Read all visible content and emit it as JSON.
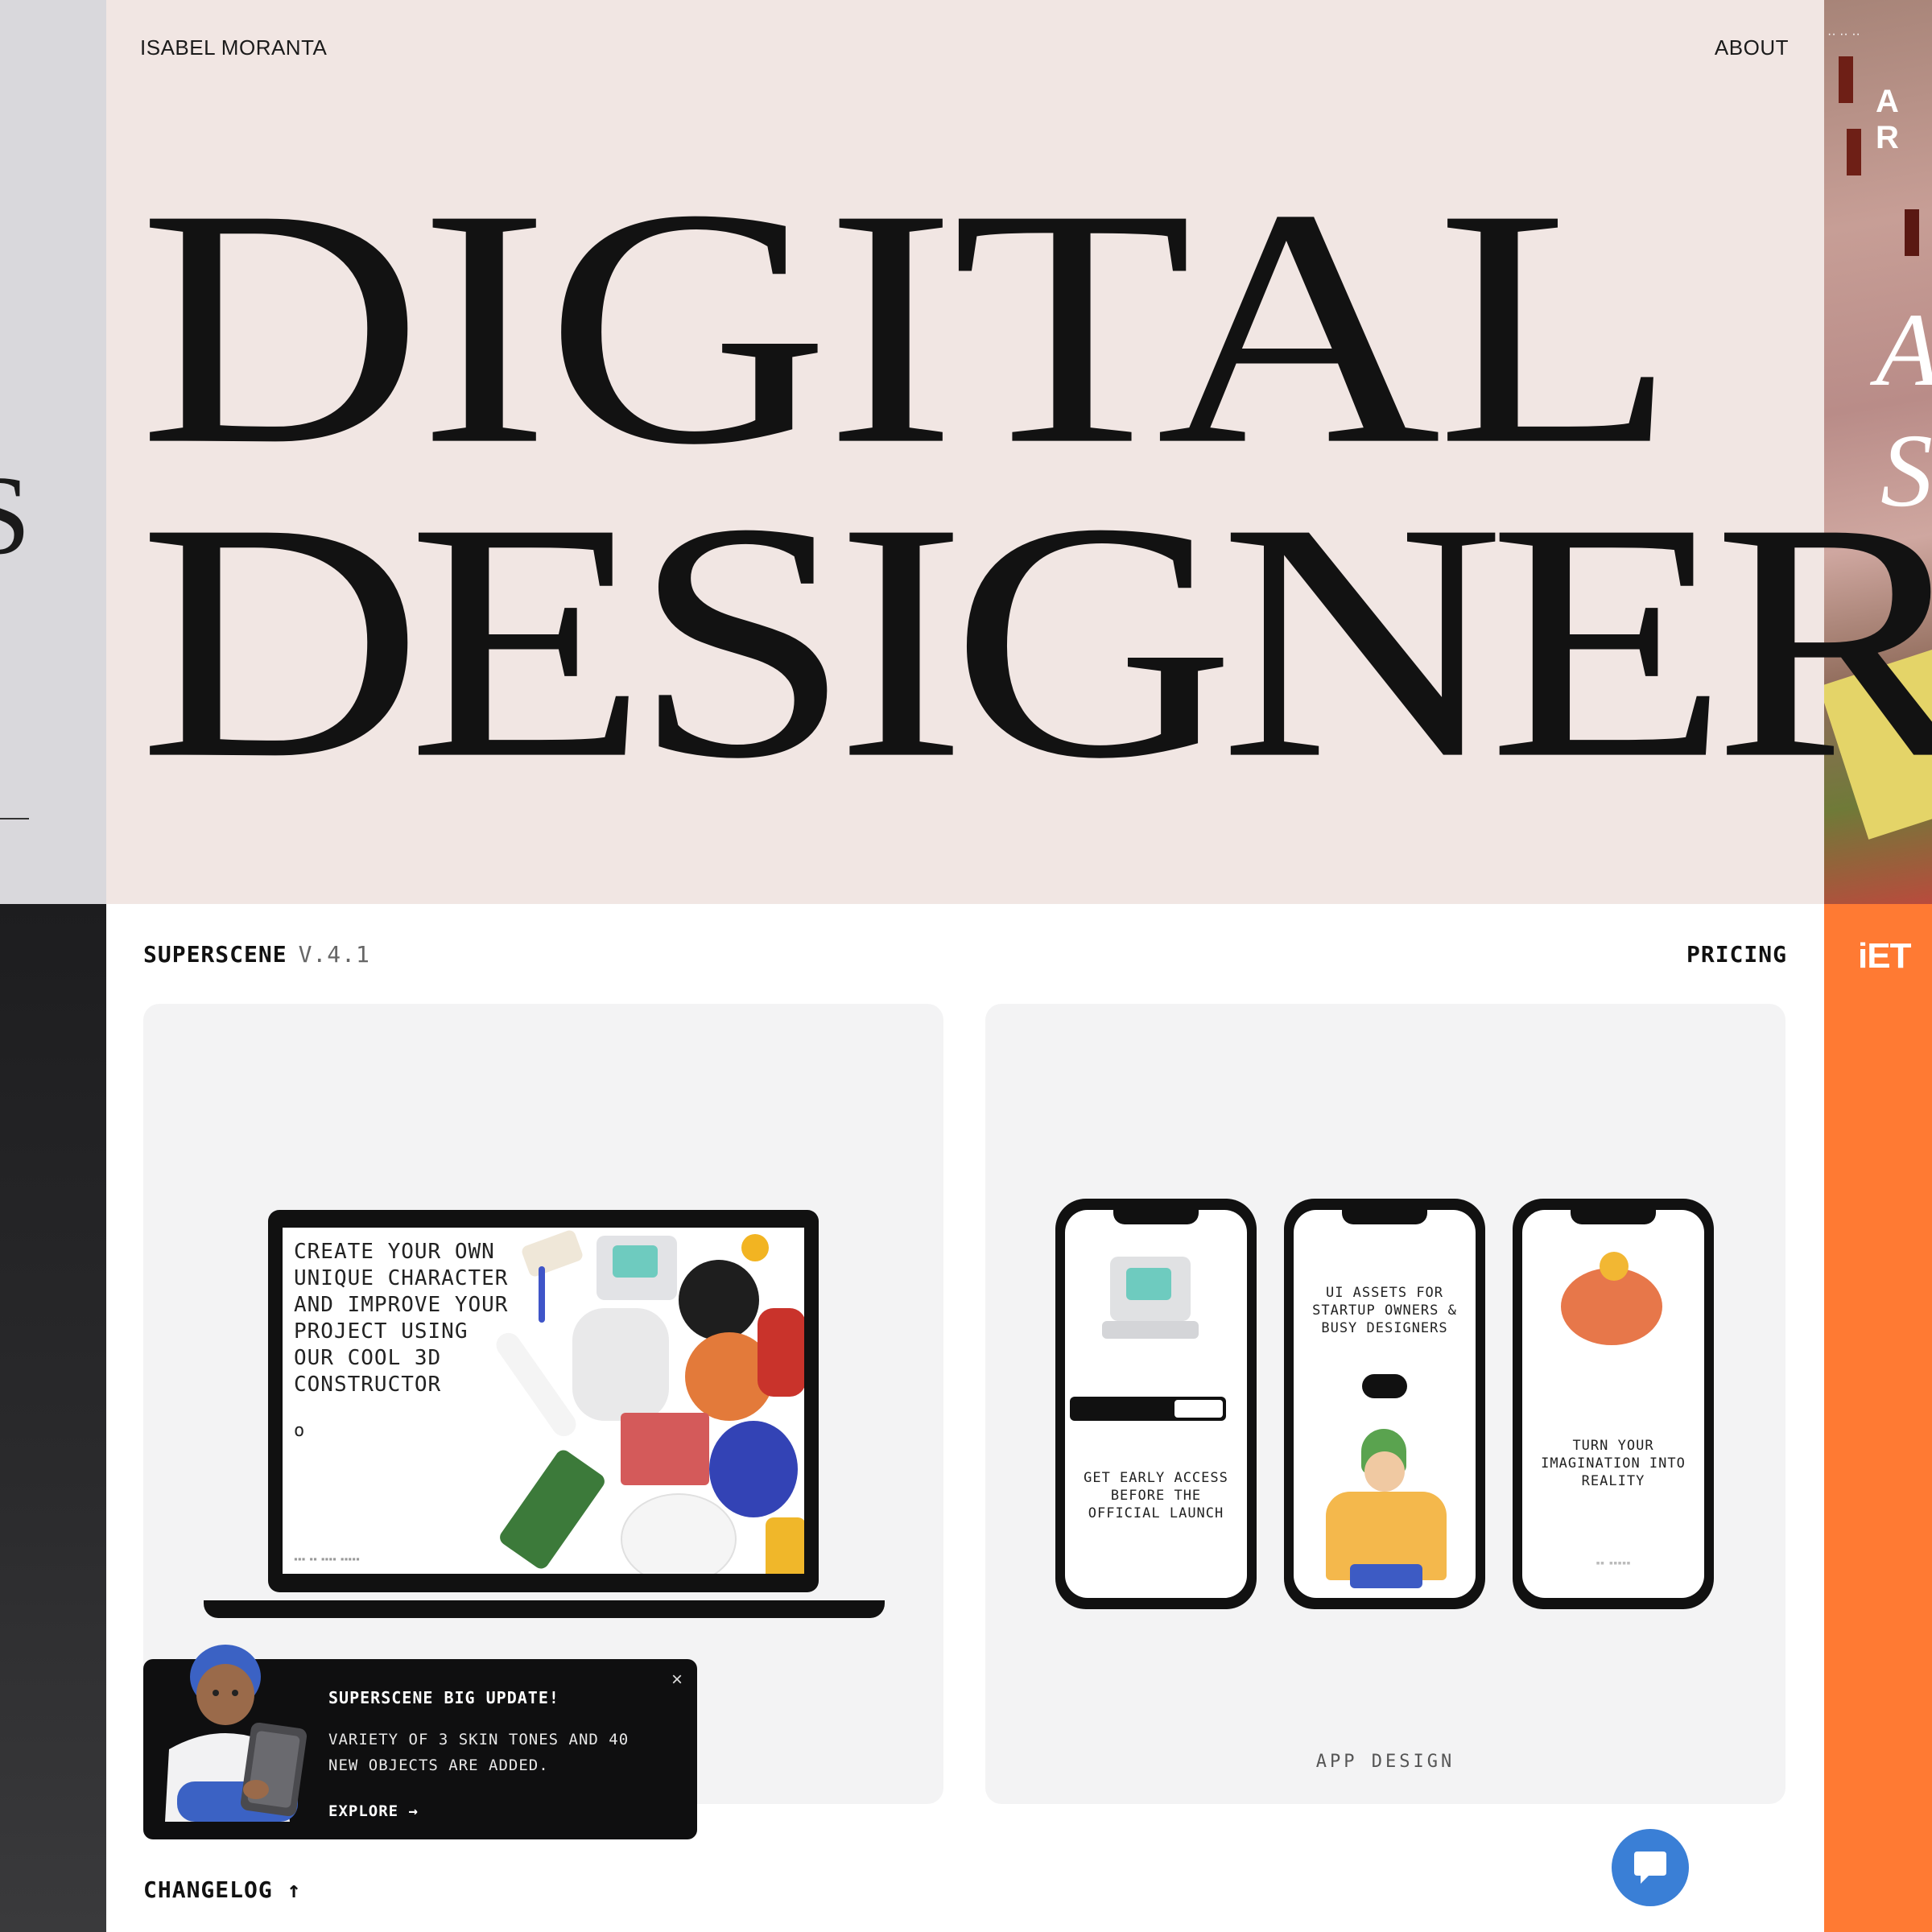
{
  "hero": {
    "author": "ISABEL MORANTA",
    "nav_about": "ABOUT",
    "headline_line1": "DIGITAL",
    "headline_line2": "DESIGNER",
    "background": "#f1e6e3"
  },
  "app": {
    "brand": "SUPERSCENE",
    "version": "V.4.1",
    "nav_pricing": "PRICING",
    "laptop_card": {
      "screen_copy": "CREATE YOUR OWN UNIQUE CHARACTER AND IMPROVE YOUR PROJECT USING OUR COOL 3D CONSTRUCTOR"
    },
    "phones_card": {
      "caption": "APP DESIGN",
      "phone1_text": "GET EARLY ACCESS BEFORE THE OFFICIAL LAUNCH",
      "phone2_text": "UI ASSETS FOR STARTUP OWNERS & BUSY DESIGNERS",
      "phone3_text": "TURN YOUR IMAGINATION INTO REALITY"
    },
    "notification": {
      "title": "SUPERSCENE BIG UPDATE!",
      "body": "VARIETY OF 3 SKIN TONES AND 40 NEW OBJECTS ARE ADDED.",
      "cta": "EXPLORE →",
      "close_icon": "close-icon"
    },
    "changelog": "CHANGELOG ↑",
    "chat_icon": "chat-bubble-icon",
    "chat_color": "#3a7fd6"
  },
  "edges": {
    "right_top_label": "A R",
    "right_bottom_brand": "iET",
    "right_bottom_color": "#ff7a33"
  }
}
